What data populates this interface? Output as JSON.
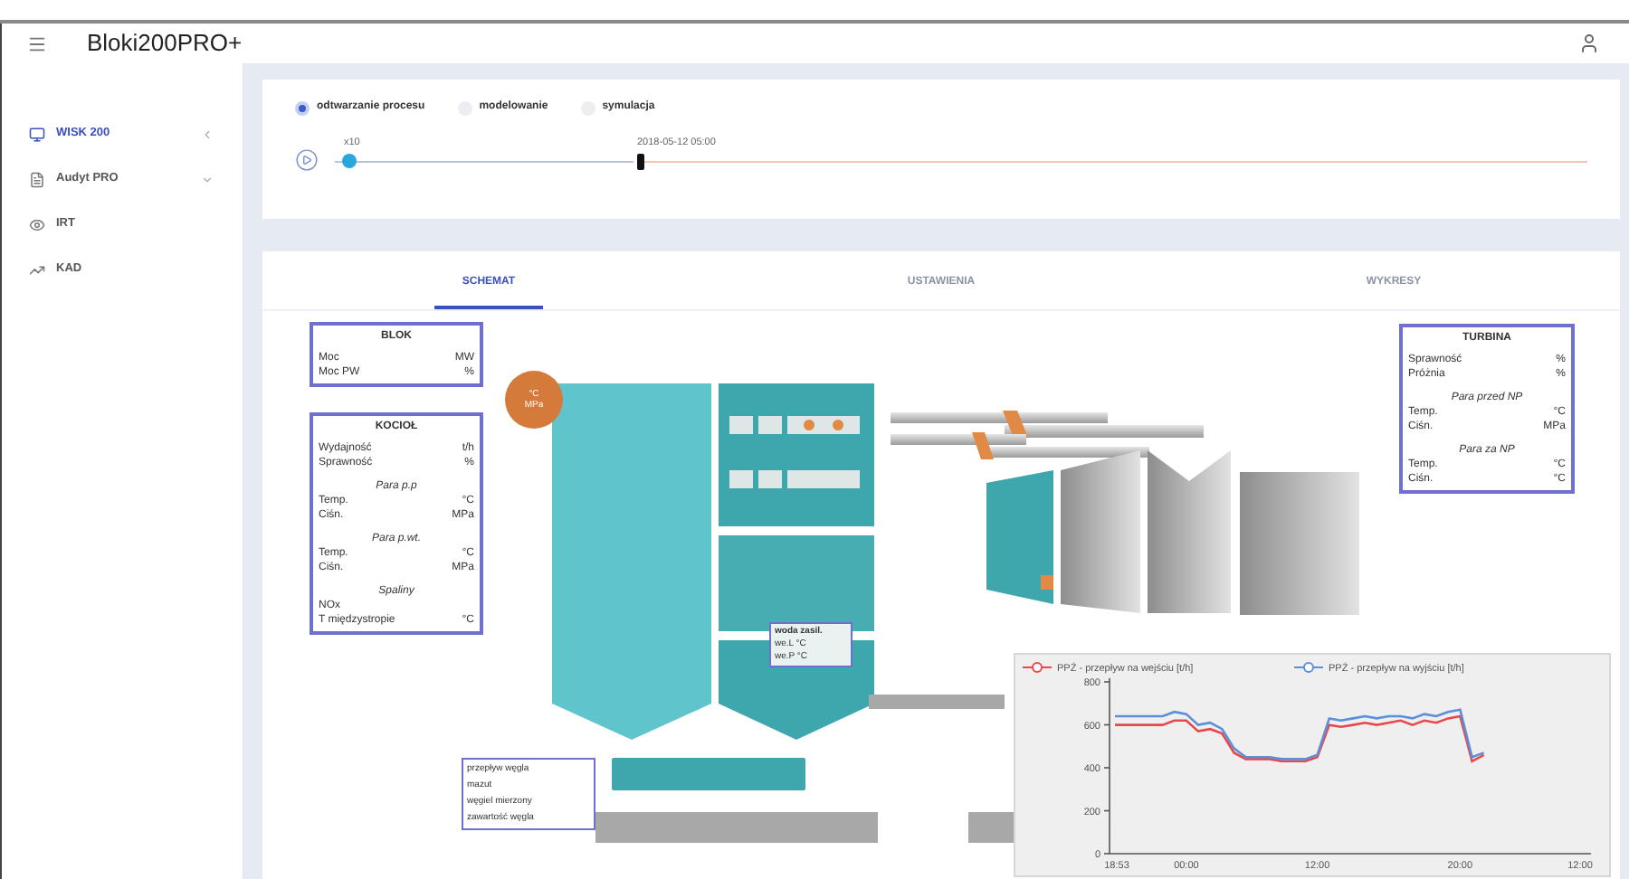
{
  "app": {
    "title": "Bloki200PRO+"
  },
  "sidebar": {
    "items": [
      {
        "kind": "monitor",
        "label": "WISK 200",
        "selected": true,
        "expanded": false
      },
      {
        "kind": "document",
        "label": "Audyt PRO",
        "selected": false,
        "expanded": true
      },
      {
        "kind": "eye",
        "label": "IRT",
        "selected": false
      },
      {
        "kind": "trend",
        "label": "KAD",
        "selected": false
      }
    ]
  },
  "modes": [
    {
      "label": "odtwarzanie procesu",
      "selected": true
    },
    {
      "label": "modelowanie",
      "selected": false
    },
    {
      "label": "symulacja",
      "selected": false
    }
  ],
  "playback": {
    "speed": {
      "label": "x10",
      "level": 0.03
    },
    "time": {
      "label": "2018-05-12 05:00",
      "level": 0
    }
  },
  "tabs": [
    {
      "label": "SCHEMAT",
      "selected": true
    },
    {
      "label": "USTAWIENIA",
      "selected": false
    },
    {
      "label": "WYKRESY",
      "selected": false
    }
  ],
  "blok": {
    "title": "BLOK",
    "rows": [
      {
        "kind": "row",
        "label": "Moc",
        "unit": "MW"
      },
      {
        "kind": "row",
        "label": "Moc PW",
        "unit": "%"
      }
    ]
  },
  "kociol": {
    "title": "KOCIOŁ",
    "rows": [
      {
        "kind": "row",
        "label": "Wydajność",
        "unit": "t/h"
      },
      {
        "kind": "row",
        "label": "Sprawność",
        "unit": "%"
      },
      {
        "kind": "heading",
        "label": "Para p.p"
      },
      {
        "kind": "row",
        "label": "Temp.",
        "unit": "°C"
      },
      {
        "kind": "row",
        "label": "Ciśn.",
        "unit": "MPa"
      },
      {
        "kind": "heading",
        "label": "Para p.wt."
      },
      {
        "kind": "row",
        "label": "Temp.",
        "unit": "°C"
      },
      {
        "kind": "row",
        "label": "Ciśn.",
        "unit": "MPa"
      },
      {
        "kind": "heading",
        "label": "Spaliny"
      },
      {
        "kind": "row",
        "label": "NOx",
        "unit": ""
      },
      {
        "kind": "row",
        "label": "T międzystropie",
        "unit": "°C"
      }
    ]
  },
  "turbina": {
    "title": "TURBINA",
    "rows": [
      {
        "kind": "row",
        "label": "Sprawność",
        "unit": "%"
      },
      {
        "kind": "row",
        "label": "Próżnia",
        "unit": "%"
      },
      {
        "kind": "heading",
        "label": "Para przed NP"
      },
      {
        "kind": "row",
        "label": "Temp.",
        "unit": "°C"
      },
      {
        "kind": "row",
        "label": "Ciśn.",
        "unit": "MPa"
      },
      {
        "kind": "heading",
        "label": "Para za NP"
      },
      {
        "kind": "row",
        "label": "Temp.",
        "unit": "°C"
      },
      {
        "kind": "row",
        "label": "Ciśn.",
        "unit": "°C"
      }
    ]
  },
  "boiler_gauge": {
    "lines": [
      "°C",
      "MPa"
    ]
  },
  "feed_water": {
    "title": "woda zasil.",
    "lines": [
      "we.L °C",
      "we.P °C"
    ]
  },
  "coal": {
    "lines": [
      "przepływ węgla",
      "mazut",
      "węgiel mierzony",
      "zawartość węgla"
    ]
  },
  "chart": {
    "chart_data": {
      "type": "line",
      "categories": [
        "18:53",
        null,
        null,
        null,
        null,
        null,
        "00:00",
        null,
        null,
        null,
        null,
        null,
        null,
        null,
        null,
        null,
        null,
        "12:00",
        null,
        null,
        null,
        null,
        null,
        null,
        null,
        null,
        null,
        null,
        null,
        "20:00",
        null,
        null,
        null,
        null,
        null,
        null,
        null,
        null,
        null,
        null,
        "12:00"
      ],
      "series": [
        {
          "name": "PPŹ - przepływ na wejściu [t/h]",
          "color": "#e8474c",
          "values": [
            600,
            600,
            600,
            600,
            600,
            620,
            620,
            570,
            580,
            560,
            470,
            440,
            440,
            440,
            430,
            430,
            430,
            450,
            600,
            590,
            600,
            610,
            600,
            610,
            620,
            600,
            620,
            610,
            630,
            640,
            430,
            460,
            null,
            null,
            null,
            null,
            null,
            null,
            null,
            null,
            null
          ]
        },
        {
          "name": "PPŹ - przepływ na wyjściu [t/h]",
          "color": "#5b8fd9",
          "values": [
            640,
            640,
            640,
            640,
            640,
            660,
            650,
            600,
            610,
            580,
            490,
            450,
            450,
            450,
            440,
            440,
            440,
            460,
            630,
            620,
            630,
            640,
            630,
            640,
            640,
            630,
            650,
            640,
            660,
            670,
            450,
            470,
            null,
            null,
            null,
            null,
            null,
            null,
            null,
            null,
            null
          ]
        }
      ],
      "legend": "top",
      "ylim": [
        0,
        800
      ],
      "yticks": [
        0,
        200,
        400,
        600,
        800
      ]
    }
  }
}
